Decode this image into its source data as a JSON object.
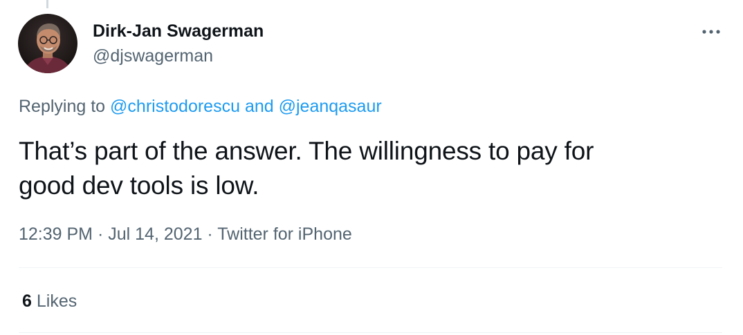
{
  "tweet": {
    "author": {
      "name": "Dirk-Jan Swagerman",
      "handle": "@djswagerman",
      "avatar_icon": "profile-photo"
    },
    "reply_context": {
      "prefix": "Replying to",
      "mentions": [
        "@christodorescu",
        "@jeanqasaur"
      ],
      "conjunction": "and"
    },
    "text_line1": "That’s part of the answer. The willingness to pay for",
    "text_line2": "good dev tools is low.",
    "time": "12:39 PM",
    "date": "Jul 14, 2021",
    "source": "Twitter for iPhone",
    "separator": "·",
    "likes": {
      "count": "6",
      "label": "Likes"
    },
    "more_icon": "more-horizontal-icon"
  },
  "colors": {
    "text_primary": "#0f1419",
    "text_secondary": "#536471",
    "accent": "#1d9bf0",
    "divider": "#eff3f4"
  }
}
